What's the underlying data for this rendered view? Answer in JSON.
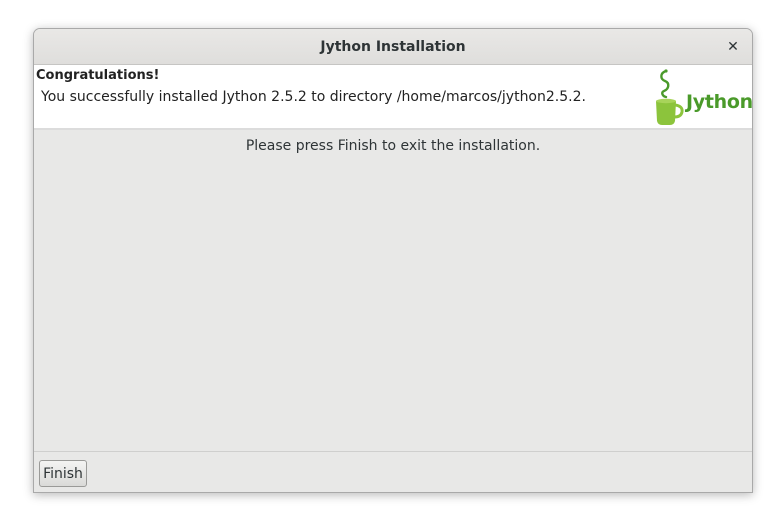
{
  "window": {
    "title": "Jython Installation",
    "close_glyph": "✕"
  },
  "header": {
    "heading": "Congratulations!",
    "message": "You successfully installed Jython 2.5.2 to directory /home/marcos/jython2.5.2.",
    "logo_text": "Jython",
    "logo_icon": "jython-cup-logo",
    "brand_color": "#4a9a2a"
  },
  "main": {
    "instruction": "Please press Finish to exit the installation."
  },
  "footer": {
    "finish_label": "Finish"
  }
}
